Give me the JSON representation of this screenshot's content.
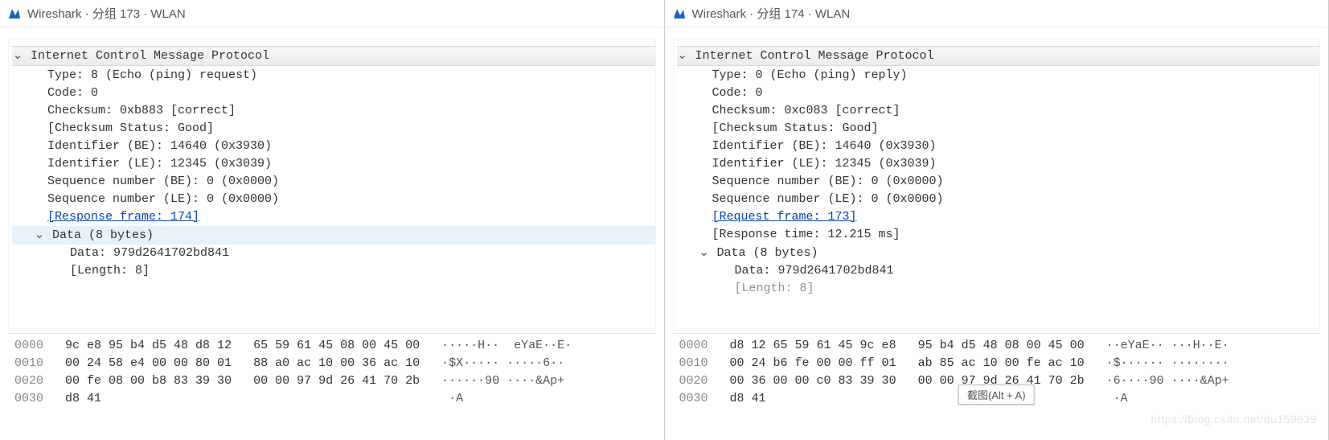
{
  "left": {
    "title": "Wireshark · 分组 173 · WLAN",
    "protocol_header": "Internet Control Message Protocol",
    "fields": {
      "type": "Type: 8 (Echo (ping) request)",
      "code": "Code: 0",
      "checksum": "Checksum: 0xb883 [correct]",
      "checksum_status": "[Checksum Status: Good]",
      "id_be": "Identifier (BE): 14640 (0x3930)",
      "id_le": "Identifier (LE): 12345 (0x3039)",
      "seq_be": "Sequence number (BE): 0 (0x0000)",
      "seq_le": "Sequence number (LE): 0 (0x0000)",
      "ref_link": "[Response frame: 174]"
    },
    "data_header": "Data (8 bytes)",
    "data_fields": {
      "data": "Data: 979d2641702bd841",
      "length": "[Length: 8]"
    },
    "hex": [
      {
        "off": "0000",
        "b": "9c e8 95 b4 d5 48 d8 12   65 59 61 45 08 00 45 00",
        "a": "·····H··  eYaE··E·"
      },
      {
        "off": "0010",
        "b": "00 24 58 e4 00 00 80 01   88 a0 ac 10 00 36 ac 10",
        "a": "·$X····· ·····6··"
      },
      {
        "off": "0020",
        "b": "00 fe 08 00 b8 83 39 30   00 00 97 9d 26 41 70 2b",
        "a": "······90 ····&Ap+"
      },
      {
        "off": "0030",
        "b": "d8 41",
        "a": "·A"
      }
    ]
  },
  "right": {
    "title": "Wireshark · 分组 174 · WLAN",
    "protocol_header": "Internet Control Message Protocol",
    "fields": {
      "type": "Type: 0 (Echo (ping) reply)",
      "code": "Code: 0",
      "checksum": "Checksum: 0xc083 [correct]",
      "checksum_status": "[Checksum Status: Good]",
      "id_be": "Identifier (BE): 14640 (0x3930)",
      "id_le": "Identifier (LE): 12345 (0x3039)",
      "seq_be": "Sequence number (BE): 0 (0x0000)",
      "seq_le": "Sequence number (LE): 0 (0x0000)",
      "ref_link": "[Request frame: 173]",
      "resp_time": "[Response time: 12.215 ms]"
    },
    "data_header": "Data (8 bytes)",
    "data_fields": {
      "data": "Data: 979d2641702bd841",
      "length": "[Length: 8]"
    },
    "hex": [
      {
        "off": "0000",
        "b": "d8 12 65 59 61 45 9c e8   95 b4 d5 48 08 00 45 00",
        "a": "··eYaE·· ···H··E·"
      },
      {
        "off": "0010",
        "b": "00 24 b6 fe 00 00 ff 01   ab 85 ac 10 00 fe ac 10",
        "a": "·$······ ········"
      },
      {
        "off": "0020",
        "b": "00 36 00 00 c0 83 39 30   00 00 97 9d 26 41 70 2b",
        "a": "·6····90 ····&Ap+"
      },
      {
        "off": "0030",
        "b": "d8 41",
        "a": "·A"
      }
    ],
    "snip_label": "截图(Alt + A)",
    "watermark": "https://blog.csdn.net/du159639"
  }
}
